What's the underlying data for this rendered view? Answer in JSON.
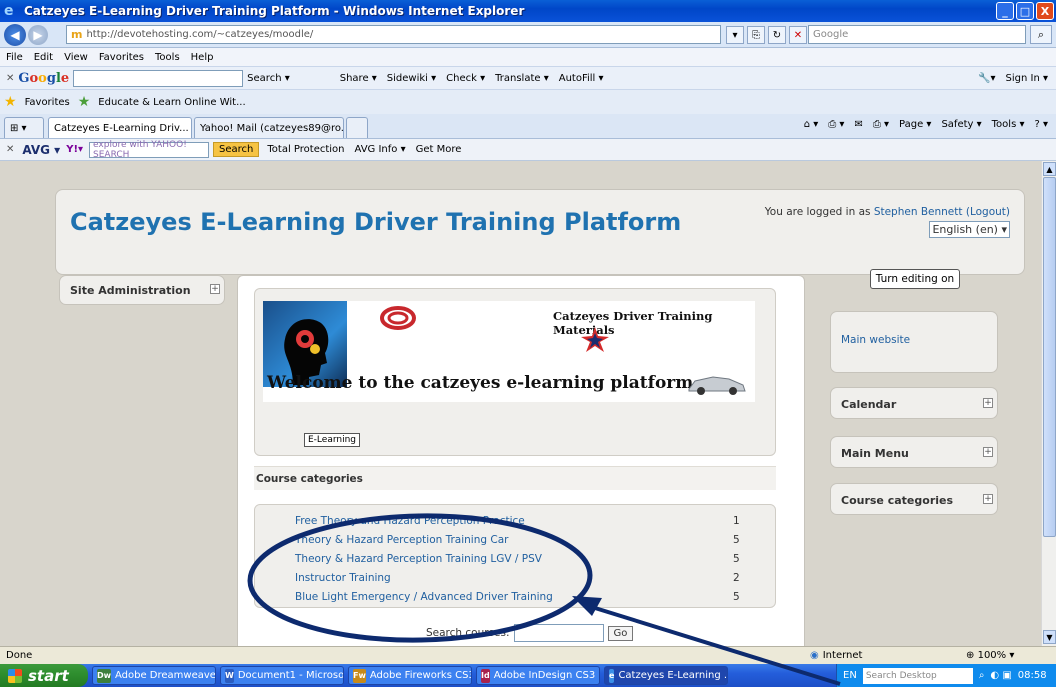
{
  "window": {
    "title": "Catzeyes E-Learning Driver Training Platform - Windows Internet Explorer",
    "minimize": "_",
    "maximize": "□",
    "close": "X"
  },
  "address": {
    "url": "http://devotehosting.com/~catzeyes/moodle/",
    "search_placeholder": "Google"
  },
  "menu": [
    "File",
    "Edit",
    "View",
    "Favorites",
    "Tools",
    "Help"
  ],
  "google_toolbar": {
    "logo_letters": [
      "G",
      "o",
      "o",
      "g",
      "l",
      "e"
    ],
    "items": [
      "Search ▾",
      "Share ▾",
      "Sidewiki ▾",
      "Check ▾",
      "Translate ▾",
      "AutoFill ▾"
    ],
    "sign_in": "Sign In ▾"
  },
  "favorites": {
    "label": "Favorites",
    "link": "Educate & Learn Online Wit..."
  },
  "tabs": [
    {
      "label": "Catzeyes E-Learning Driv...",
      "close": "X"
    },
    {
      "label": "Yahoo! Mail (catzeyes89@ro..."
    }
  ],
  "command_bar": [
    "Page ▾",
    "Safety ▾",
    "Tools ▾"
  ],
  "avg_toolbar": {
    "avg": "AVG ▾",
    "yahoo": "Y!▾",
    "search_placeholder": "explore with YAHOO! SEARCH",
    "search_button": "Search",
    "items": [
      "Total Protection",
      "AVG Info ▾",
      "Get More"
    ]
  },
  "page": {
    "site_title": "Catzeyes E-Learning Driver Training Platform",
    "logged_in_text": "You are logged in as ",
    "user_name": "Stephen Bennett",
    "logout": "(Logout)",
    "language": "English (en) ▾",
    "site_admin": "Site Administration",
    "turn_editing": "Turn editing on",
    "banner_materials": "Catzeyes Driver Training Materials",
    "banner_welcome": "Welcome to the catzeyes e-learning platform",
    "image_tooltip": "E-Learning",
    "course_categories_heading": "Course categories",
    "categories": [
      {
        "name": "Free Theory and Hazard Perception Practice",
        "count": "1"
      },
      {
        "name": "Theory & Hazard Perception Training Car",
        "count": "5"
      },
      {
        "name": "Theory & Hazard Perception Training LGV / PSV",
        "count": "5"
      },
      {
        "name": "Instructor Training",
        "count": "2"
      },
      {
        "name": "Blue Light Emergency / Advanced Driver Training",
        "count": "5"
      }
    ],
    "search_courses_label": "Search courses:",
    "go_button": "Go",
    "right_blocks": {
      "main_website": "Main website",
      "calendar": "Calendar",
      "main_menu": "Main Menu",
      "course_categories": "Course categories"
    }
  },
  "status": {
    "left": "Done",
    "zone": "Internet",
    "zoom": "100%"
  },
  "taskbar": {
    "start": "start",
    "items": [
      {
        "label": "Adobe Dreamweaver ...",
        "icon": "Dw"
      },
      {
        "label": "Document1 - Microsof...",
        "icon": "W"
      },
      {
        "label": "Adobe Fireworks CS3",
        "icon": "Fw"
      },
      {
        "label": "Adobe InDesign CS3 ...",
        "icon": "Id"
      },
      {
        "label": "Catzeyes E-Learning ...",
        "icon": "e"
      }
    ],
    "lang": "EN",
    "search_desktop": "Search Desktop",
    "clock": "08:58"
  },
  "colors": {
    "link": "#2160a0",
    "title_blue": "#1f72b0",
    "annotation": "#0d2a6e"
  }
}
